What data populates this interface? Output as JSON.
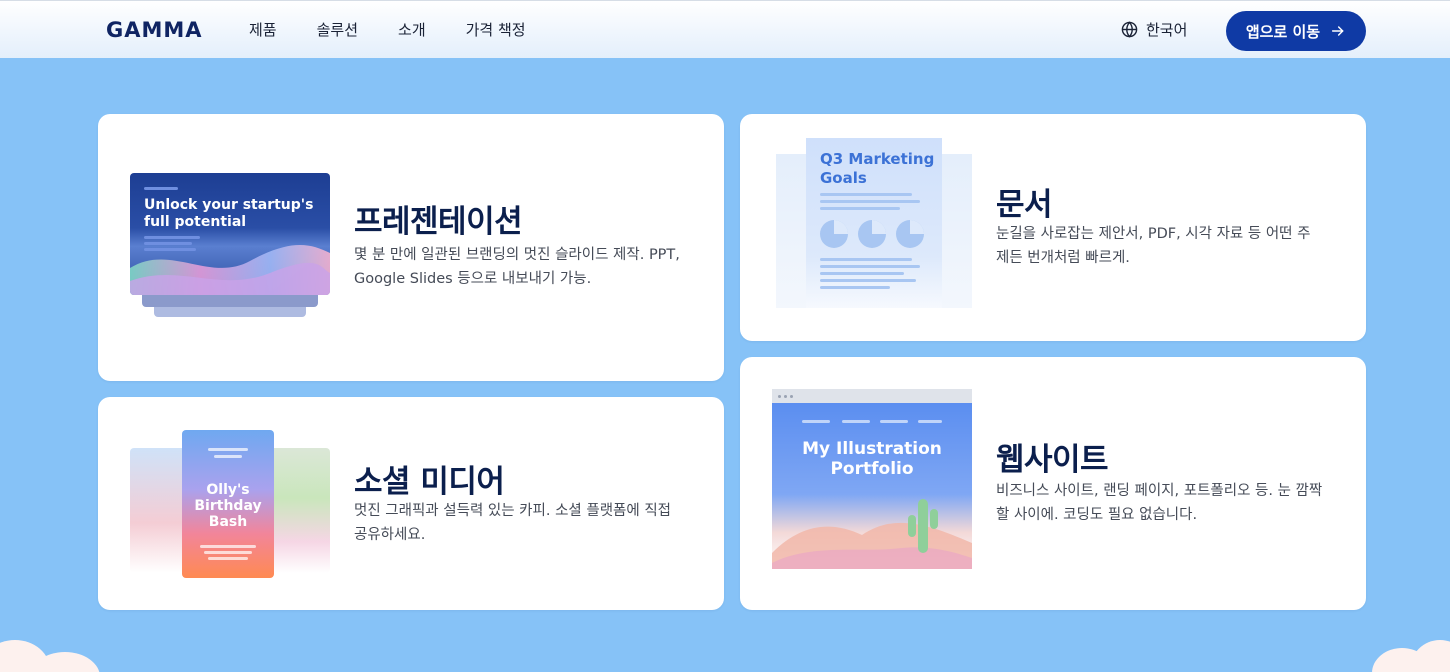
{
  "header": {
    "logo": "GAMMA",
    "nav": [
      "제품",
      "솔루션",
      "소개",
      "가격 책정"
    ],
    "language": "한국어",
    "cta": "앱으로 이동"
  },
  "cards": {
    "presentation": {
      "title": "프레젠테이션",
      "desc_line1": "몇 분 만에 일관된 브랜딩의 멋진 슬라이드 제작. PPT,",
      "desc_line2": "Google Slides 등으로 내보내기 가능.",
      "illustration_text_line1": "Unlock your startup's",
      "illustration_text_line2": "full potential"
    },
    "social": {
      "title": "소셜 미디어",
      "desc_line1": "멋진 그래픽과 설득력 있는 카피. 소셜 플랫폼에 직접",
      "desc_line2": "공유하세요.",
      "illustration_text_line1": "Olly's",
      "illustration_text_line2": "Birthday",
      "illustration_text_line3": "Bash"
    },
    "document": {
      "title": "문서",
      "desc_line1": "눈길을 사로잡는 제안서, PDF, 시각 자료 등 어떤 주",
      "desc_line2": "제든 번개처럼 빠르게.",
      "illustration_text_line1": "Q3 Marketing",
      "illustration_text_line2": "Goals"
    },
    "website": {
      "title": "웹사이트",
      "desc_line1": "비즈니스 사이트, 랜딩 페이지, 포트폴리오 등. 눈 깜짝",
      "desc_line2": "할 사이에. 코딩도 필요 없습니다.",
      "illustration_text_line1": "My Illustration",
      "illustration_text_line2": "Portfolio"
    }
  },
  "icons": {
    "language": "globe-icon",
    "cta": "arrow-right-icon"
  },
  "colors": {
    "page_background": "#86c2f7",
    "cta_background": "#0f3aa5",
    "title_text": "#0b1f4d"
  }
}
